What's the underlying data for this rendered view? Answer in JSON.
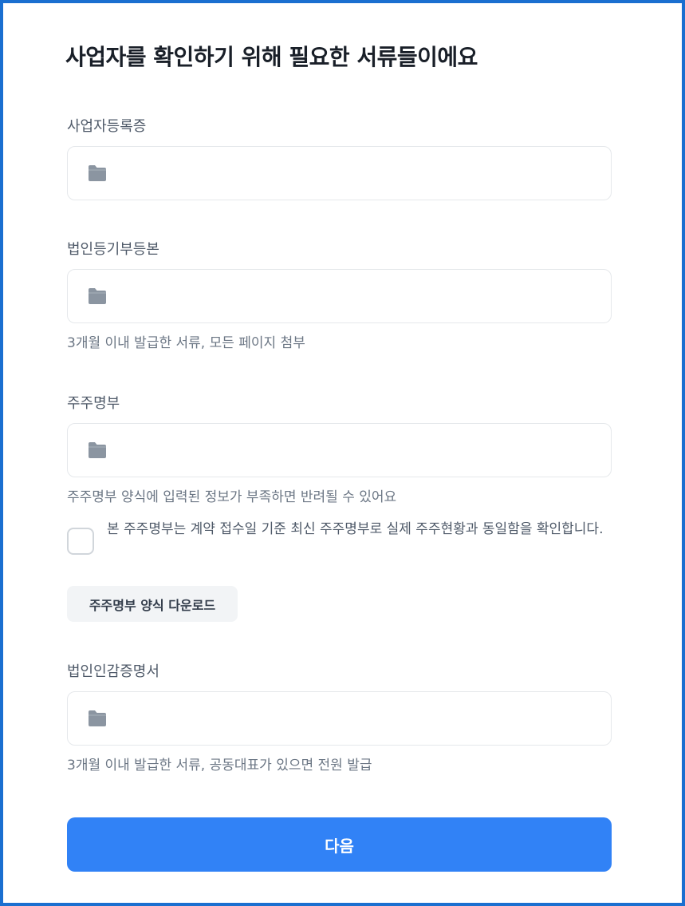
{
  "title": "사업자를 확인하기 위해 필요한 서류들이에요",
  "documents": [
    {
      "label": "사업자등록증",
      "hint": "",
      "field_icon": "folder-icon"
    },
    {
      "label": "법인등기부등본",
      "hint": "3개월 이내 발급한 서류, 모든 페이지 첨부",
      "field_icon": "folder-icon"
    },
    {
      "label": "주주명부",
      "hint": "주주명부 양식에 입력된 정보가 부족하면 반려될 수 있어요",
      "field_icon": "folder-icon"
    },
    {
      "label": "법인인감증명서",
      "hint": "3개월 이내 발급한 서류, 공동대표가 있으면 전원 발급",
      "field_icon": "folder-icon"
    }
  ],
  "confirmation": {
    "text": "본 주주명부는 계약 접수일 기준 최신 주주명부로 실제 주주현황과 동일함을 확인합니다.",
    "checked": false
  },
  "download_button": "주주명부 양식 다운로드",
  "next_button": "다음",
  "colors": {
    "frame_border": "#1a6fd0",
    "primary": "#3182f6",
    "folder_icon": "#8b95a1",
    "field_border": "#e5e8eb",
    "secondary_button_bg": "#f2f4f6"
  }
}
